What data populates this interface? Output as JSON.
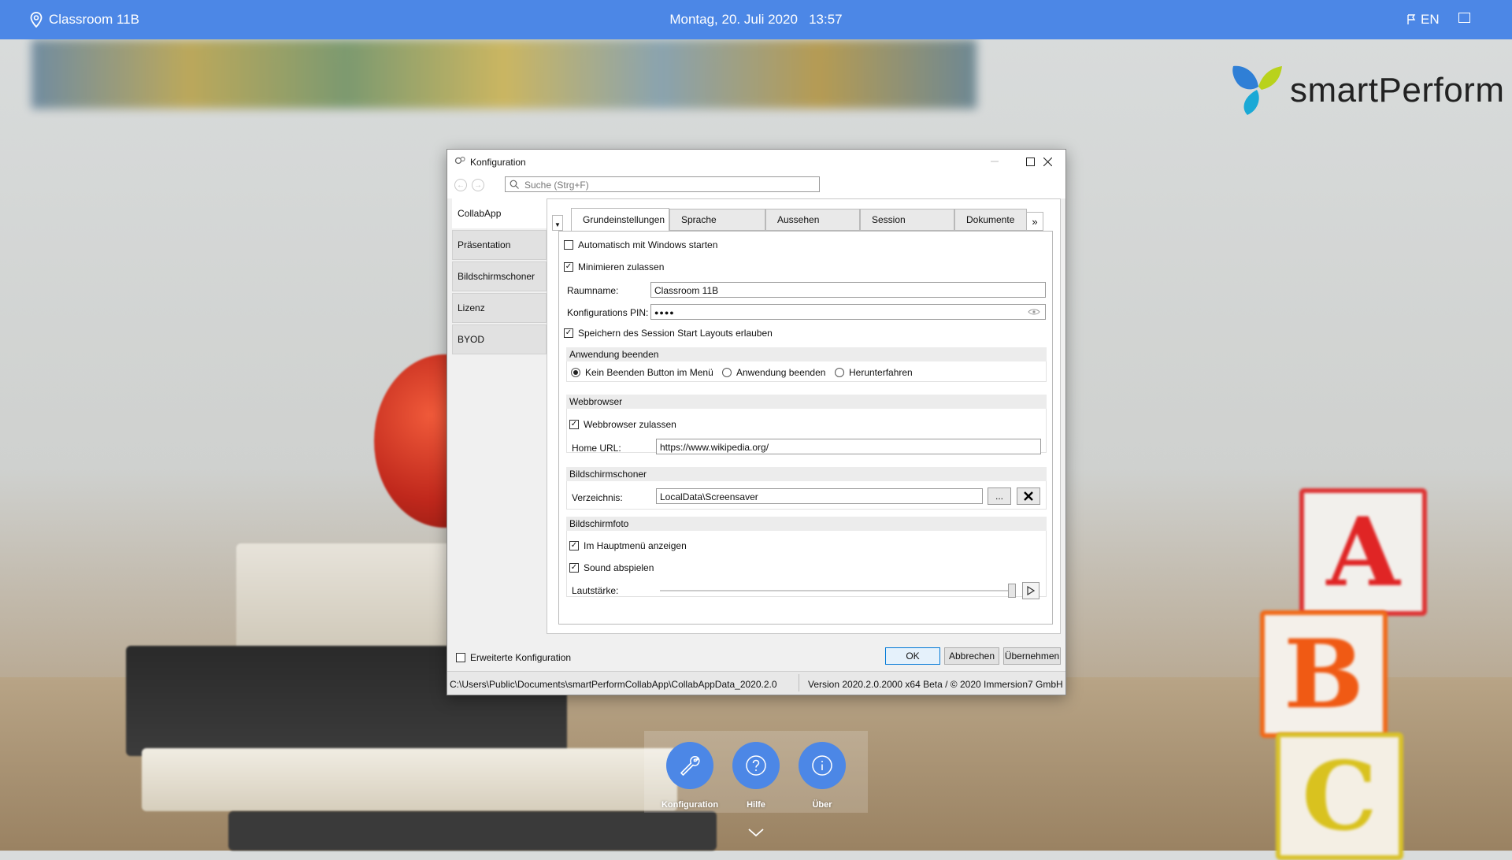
{
  "topbar": {
    "room": "Classroom 11B",
    "date": "Montag, 20. Juli 2020",
    "time": "13:57",
    "lang": "EN",
    "color": "#4c87e6"
  },
  "logo": {
    "text": "smartPerform"
  },
  "dialog": {
    "title": "Konfiguration",
    "search_placeholder": "Suche (Strg+F)",
    "left_nav": [
      "CollabApp",
      "Präsentation",
      "Bildschirmschoner",
      "Lizenz",
      "BYOD"
    ],
    "tabs": [
      "Grundeinstellungen",
      "Sprache",
      "Aussehen",
      "Session",
      "Dokumente"
    ],
    "tab_more": "»",
    "general": {
      "autostart": {
        "label": "Automatisch mit Windows starten",
        "checked": false
      },
      "minimize": {
        "label": "Minimieren zulassen",
        "checked": true
      },
      "room_label": "Raumname:",
      "room_value": "Classroom 11B",
      "pin_label": "Konfigurations PIN:",
      "pin_value": "●●●●",
      "save_layout": {
        "label": "Speichern des Session Start Layouts erlauben",
        "checked": true
      }
    },
    "quit_section": {
      "title": "Anwendung beenden",
      "options": [
        "Kein Beenden Button im Menü",
        "Anwendung beenden",
        "Herunterfahren"
      ],
      "selected": 0
    },
    "web_section": {
      "title": "Webbrowser",
      "allow": {
        "label": "Webbrowser zulassen",
        "checked": true
      },
      "home_label": "Home URL:",
      "home_value": "https://www.wikipedia.org/"
    },
    "screensaver_section": {
      "title": "Bildschirmschoner",
      "dir_label": "Verzeichnis:",
      "dir_value": "LocalData\\Screensaver",
      "browse": "..."
    },
    "screenshot_section": {
      "title": "Bildschirmfoto",
      "show_menu": {
        "label": "Im Hauptmenü anzeigen",
        "checked": true
      },
      "sound": {
        "label": "Sound abspielen",
        "checked": true
      },
      "volume_label": "Lautstärke:",
      "volume": 1.0
    },
    "advanced": {
      "label": "Erweiterte Konfiguration",
      "checked": false
    },
    "buttons": {
      "ok": "OK",
      "cancel": "Abbrechen",
      "apply": "Übernehmen"
    },
    "status_path": "C:\\Users\\Public\\Documents\\smartPerformCollabApp\\CollabAppData_2020.2.0",
    "status_version": "Version 2020.2.0.2000 x64 Beta / © 2020 Immersion7 GmbH"
  },
  "dock": {
    "items": [
      {
        "label": "Konfiguration",
        "icon": "wrench-icon"
      },
      {
        "label": "Hilfe",
        "icon": "help-icon"
      },
      {
        "label": "Über",
        "icon": "info-icon"
      }
    ]
  }
}
